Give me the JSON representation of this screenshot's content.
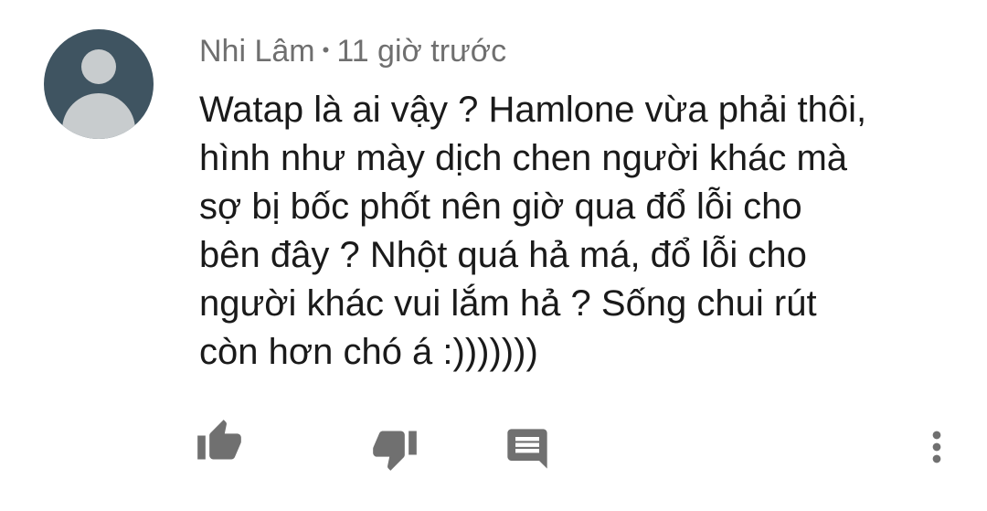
{
  "comment": {
    "author": "Nhi Lâm",
    "separator": "•",
    "time": "11 giờ trước",
    "text": "Watap là ai vậy ? Hamlone vừa phải thôi,\nhình như mày dịch chen người khác mà\nsợ bị bốc phốt nên giờ qua đổ lỗi cho\nbên đây ? Nhột quá hả má, đổ lỗi cho\nngười khác vui lắm hả ? Sống chui rút\ncòn hơn chó á :)))))))"
  },
  "icons": {
    "like": "thumbs-up-icon",
    "dislike": "thumbs-down-icon",
    "reply": "comment-icon",
    "more": "more-vertical-icon"
  },
  "colors": {
    "avatar_bg": "#3f5461",
    "avatar_fg": "#c8ccce",
    "meta_text": "#6f6f6f",
    "body_text": "#1a1a1a",
    "icon": "#707070"
  }
}
